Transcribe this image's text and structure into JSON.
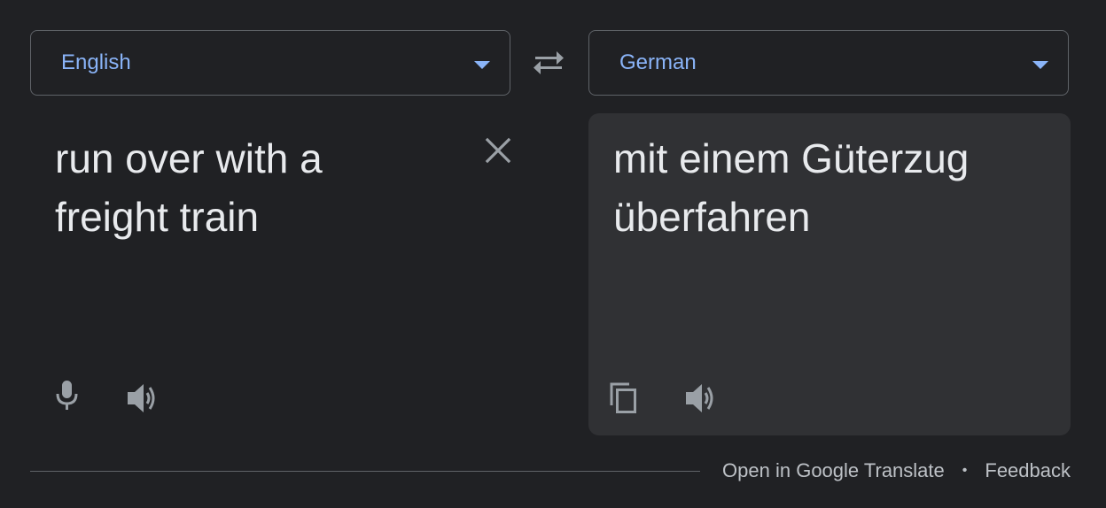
{
  "source_language": {
    "label": "English",
    "caret_icon": "caret-down-icon"
  },
  "target_language": {
    "label": "German",
    "caret_icon": "caret-down-icon"
  },
  "swap_icon": "swap-arrows-icon",
  "source": {
    "text": "run over with a freight train",
    "clear_icon": "close-icon",
    "mic_icon": "microphone-icon",
    "speaker_icon": "speaker-icon"
  },
  "target": {
    "text": "mit einem Güterzug überfahren",
    "copy_icon": "copy-icon",
    "speaker_icon": "speaker-icon"
  },
  "footer": {
    "open_link": "Open in Google Translate",
    "separator": "•",
    "feedback_link": "Feedback"
  },
  "colors": {
    "background": "#202124",
    "panel": "#303134",
    "accent": "#8ab4f8",
    "text": "#e8eaed",
    "icon": "#9aa0a6"
  }
}
